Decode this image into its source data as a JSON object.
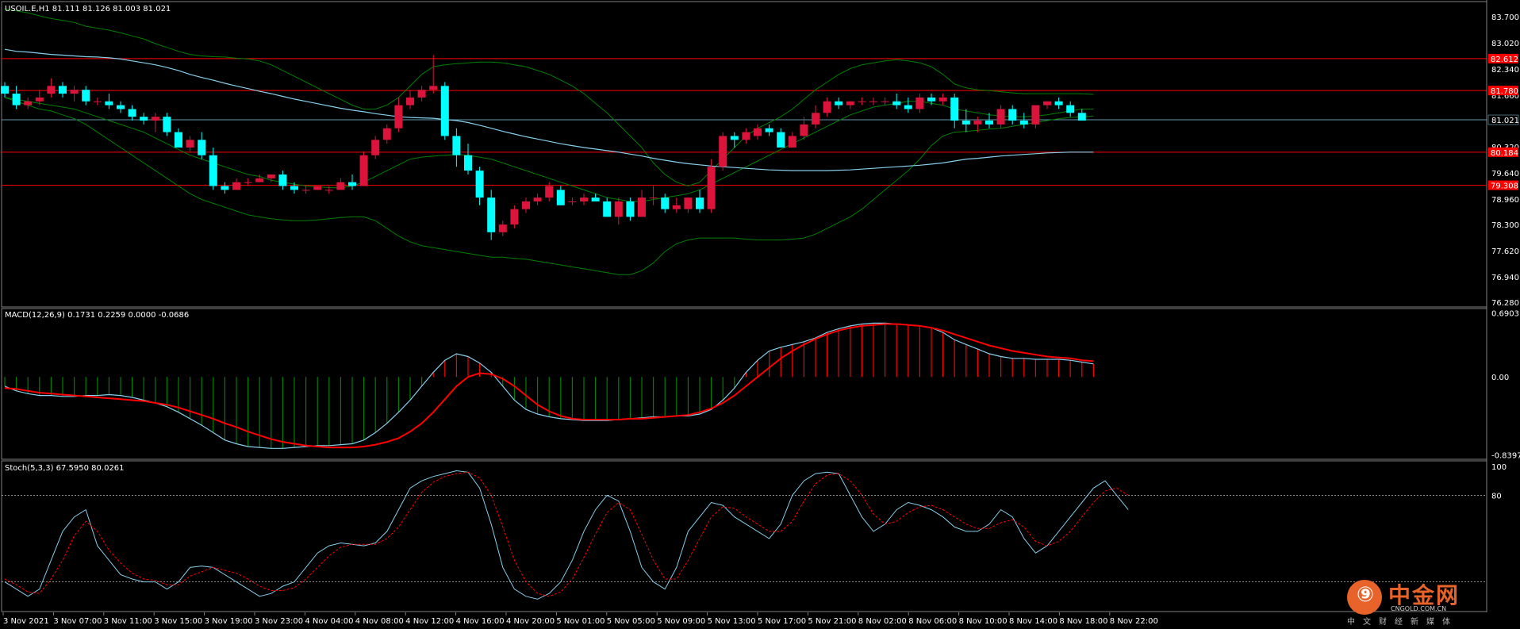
{
  "symbol_header": "USOIL.E,H1  81.111 81.126 81.003 81.021",
  "macd_header": "MACD(12,26,9) 0.1731 0.2259 0.0000 -0.0686",
  "stoch_header": "Stoch(5,3,3) 67.5950 80.0261",
  "colors": {
    "bull": "#dc143c",
    "bear": "#00ffff",
    "bands": "#008000",
    "ma": "#87ceeb",
    "signal": "#ff0000",
    "hist_pos": "#ff0000",
    "hist_neg": "#008000",
    "level": "#ff0000",
    "current": "#87ceeb"
  },
  "price_axis": {
    "ticks": [
      "83.700",
      "83.020",
      "82.340",
      "81.660",
      "81.021",
      "80.320",
      "79.640",
      "78.960",
      "78.300",
      "77.620",
      "76.940",
      "76.280"
    ],
    "ymax": 84.05,
    "ymin": 76.2
  },
  "price_levels": [
    {
      "value": 82.61,
      "label": "82.612"
    },
    {
      "value": 81.78,
      "label": "81.780"
    },
    {
      "value": 80.18,
      "label": "80.184"
    },
    {
      "value": 79.32,
      "label": "79.308"
    }
  ],
  "current_price": {
    "value": 81.021,
    "label": "81.021"
  },
  "macd_axis": {
    "ticks": [
      "0.6903",
      "0.00",
      "-0.8397"
    ],
    "ymax": 0.72,
    "ymin": -0.87
  },
  "stoch_axis": {
    "ticks": [
      "100",
      "80"
    ],
    "levels": [
      80,
      20
    ]
  },
  "time_labels": [
    "3 Nov 2021",
    "3 Nov 07:00",
    "3 Nov 11:00",
    "3 Nov 15:00",
    "3 Nov 19:00",
    "3 Nov 23:00",
    "4 Nov 04:00",
    "4 Nov 08:00",
    "4 Nov 12:00",
    "4 Nov 16:00",
    "4 Nov 20:00",
    "5 Nov 01:00",
    "5 Nov 05:00",
    "5 Nov 09:00",
    "5 Nov 13:00",
    "5 Nov 17:00",
    "5 Nov 21:00",
    "8 Nov 02:00",
    "8 Nov 06:00",
    "8 Nov 10:00",
    "8 Nov 14:00",
    "8 Nov 18:00",
    "8 Nov 22:00"
  ],
  "chart_data": {
    "type": "candlestick",
    "candles": [
      [
        81.9,
        82.0,
        81.6,
        81.7
      ],
      [
        81.7,
        81.9,
        81.3,
        81.4
      ],
      [
        81.4,
        81.6,
        81.3,
        81.5
      ],
      [
        81.5,
        81.8,
        81.4,
        81.6
      ],
      [
        81.7,
        82.1,
        81.6,
        81.9
      ],
      [
        81.9,
        82.0,
        81.6,
        81.7
      ],
      [
        81.7,
        81.9,
        81.5,
        81.8
      ],
      [
        81.8,
        81.9,
        81.4,
        81.5
      ],
      [
        81.5,
        81.6,
        81.4,
        81.5
      ],
      [
        81.5,
        81.7,
        81.3,
        81.4
      ],
      [
        81.4,
        81.5,
        81.2,
        81.3
      ],
      [
        81.3,
        81.4,
        81.0,
        81.1
      ],
      [
        81.1,
        81.2,
        80.9,
        81.0
      ],
      [
        81.0,
        81.2,
        80.7,
        81.1
      ],
      [
        81.1,
        81.2,
        80.6,
        80.7
      ],
      [
        80.7,
        80.8,
        80.3,
        80.3
      ],
      [
        80.3,
        80.6,
        80.2,
        80.5
      ],
      [
        80.5,
        80.7,
        80.0,
        80.1
      ],
      [
        80.1,
        80.3,
        79.2,
        79.3
      ],
      [
        79.3,
        79.4,
        79.1,
        79.2
      ],
      [
        79.2,
        79.5,
        79.2,
        79.4
      ],
      [
        79.4,
        79.5,
        79.3,
        79.4
      ],
      [
        79.4,
        79.6,
        79.4,
        79.5
      ],
      [
        79.5,
        79.6,
        79.4,
        79.6
      ],
      [
        79.6,
        79.7,
        79.2,
        79.3
      ],
      [
        79.3,
        79.4,
        79.1,
        79.2
      ],
      [
        79.2,
        79.3,
        79.1,
        79.2
      ],
      [
        79.2,
        79.3,
        79.2,
        79.3
      ],
      [
        79.2,
        79.3,
        79.1,
        79.2
      ],
      [
        79.2,
        79.5,
        79.2,
        79.4
      ],
      [
        79.4,
        79.6,
        79.2,
        79.3
      ],
      [
        79.3,
        80.2,
        79.3,
        80.1
      ],
      [
        80.1,
        80.6,
        80.0,
        80.5
      ],
      [
        80.5,
        80.9,
        80.4,
        80.8
      ],
      [
        80.8,
        81.6,
        80.7,
        81.4
      ],
      [
        81.4,
        81.8,
        81.3,
        81.6
      ],
      [
        81.6,
        81.9,
        81.5,
        81.8
      ],
      [
        81.8,
        82.7,
        81.7,
        81.9
      ],
      [
        81.9,
        82.0,
        80.5,
        80.6
      ],
      [
        80.6,
        80.8,
        79.8,
        80.1
      ],
      [
        80.1,
        80.4,
        79.6,
        79.7
      ],
      [
        79.7,
        79.8,
        78.8,
        79.0
      ],
      [
        79.0,
        79.2,
        77.9,
        78.1
      ],
      [
        78.1,
        78.4,
        78.0,
        78.3
      ],
      [
        78.3,
        78.8,
        78.2,
        78.7
      ],
      [
        78.7,
        79.0,
        78.6,
        78.9
      ],
      [
        78.9,
        79.1,
        78.8,
        79.0
      ],
      [
        79.0,
        79.4,
        78.9,
        79.3
      ],
      [
        79.2,
        79.3,
        78.8,
        78.8
      ],
      [
        78.9,
        79.0,
        78.8,
        78.9
      ],
      [
        78.9,
        79.1,
        78.8,
        79.0
      ],
      [
        79.0,
        79.1,
        78.9,
        78.9
      ],
      [
        78.9,
        79.0,
        78.5,
        78.5
      ],
      [
        78.5,
        79.0,
        78.3,
        78.9
      ],
      [
        78.9,
        79.0,
        78.4,
        78.5
      ],
      [
        78.5,
        79.2,
        78.5,
        79.0
      ],
      [
        79.0,
        79.3,
        78.8,
        79.0
      ],
      [
        79.0,
        79.1,
        78.6,
        78.7
      ],
      [
        78.7,
        79.0,
        78.6,
        78.8
      ],
      [
        78.7,
        79.0,
        78.6,
        79.0
      ],
      [
        79.0,
        79.2,
        78.6,
        78.7
      ],
      [
        78.7,
        80.0,
        78.6,
        79.8
      ],
      [
        79.8,
        80.7,
        79.7,
        80.6
      ],
      [
        80.6,
        80.7,
        80.3,
        80.5
      ],
      [
        80.5,
        80.8,
        80.4,
        80.7
      ],
      [
        80.6,
        80.9,
        80.5,
        80.8
      ],
      [
        80.8,
        80.9,
        80.6,
        80.7
      ],
      [
        80.7,
        80.8,
        80.3,
        80.3
      ],
      [
        80.3,
        80.7,
        80.3,
        80.6
      ],
      [
        80.6,
        81.1,
        80.5,
        80.9
      ],
      [
        80.9,
        81.4,
        80.8,
        81.2
      ],
      [
        81.2,
        81.6,
        81.1,
        81.5
      ],
      [
        81.5,
        81.6,
        81.3,
        81.4
      ],
      [
        81.4,
        81.5,
        81.3,
        81.5
      ],
      [
        81.5,
        81.6,
        81.4,
        81.5
      ],
      [
        81.5,
        81.6,
        81.4,
        81.5
      ],
      [
        81.5,
        81.6,
        81.4,
        81.5
      ],
      [
        81.5,
        81.7,
        81.3,
        81.4
      ],
      [
        81.4,
        81.6,
        81.2,
        81.3
      ],
      [
        81.3,
        81.7,
        81.2,
        81.6
      ],
      [
        81.6,
        81.7,
        81.4,
        81.5
      ],
      [
        81.5,
        81.7,
        81.4,
        81.6
      ],
      [
        81.6,
        81.7,
        80.8,
        81.0
      ],
      [
        81.0,
        81.3,
        80.7,
        80.9
      ],
      [
        80.9,
        81.1,
        80.7,
        81.0
      ],
      [
        81.0,
        81.2,
        80.8,
        80.9
      ],
      [
        80.9,
        81.4,
        80.8,
        81.3
      ],
      [
        81.3,
        81.4,
        80.9,
        81.0
      ],
      [
        81.0,
        81.2,
        80.8,
        80.9
      ],
      [
        80.9,
        81.4,
        80.8,
        81.4
      ],
      [
        81.4,
        81.5,
        81.3,
        81.5
      ],
      [
        81.5,
        81.6,
        81.3,
        81.4
      ],
      [
        81.4,
        81.5,
        81.1,
        81.2
      ],
      [
        81.2,
        81.3,
        81.0,
        81.0
      ]
    ],
    "ma": [
      82.85,
      82.8,
      82.78,
      82.75,
      82.72,
      82.7,
      82.68,
      82.66,
      82.65,
      82.63,
      82.6,
      82.55,
      82.5,
      82.45,
      82.38,
      82.3,
      82.2,
      82.12,
      82.05,
      81.97,
      81.9,
      81.83,
      81.76,
      81.7,
      81.63,
      81.56,
      81.5,
      81.44,
      81.38,
      81.32,
      81.27,
      81.23,
      81.18,
      81.14,
      81.1,
      81.08,
      81.07,
      81.06,
      81.03,
      81.0,
      80.95,
      80.88,
      80.8,
      80.72,
      80.65,
      80.58,
      80.52,
      80.46,
      80.4,
      80.35,
      80.3,
      80.26,
      80.22,
      80.18,
      80.13,
      80.08,
      80.02,
      79.97,
      79.92,
      79.88,
      79.85,
      79.82,
      79.8,
      79.78,
      79.76,
      79.74,
      79.72,
      79.71,
      79.7,
      79.7,
      79.7,
      79.7,
      79.71,
      79.72,
      79.74,
      79.76,
      79.78,
      79.8,
      79.82,
      79.84,
      79.87,
      79.9,
      79.95,
      80.0,
      80.02,
      80.05,
      80.08,
      80.1,
      80.12,
      80.14,
      80.16,
      80.17,
      80.18,
      80.18,
      80.18
    ],
    "bb_upper": [
      83.9,
      83.85,
      83.8,
      83.72,
      83.65,
      83.6,
      83.55,
      83.45,
      83.4,
      83.35,
      83.28,
      83.2,
      83.12,
      83.0,
      82.9,
      82.8,
      82.72,
      82.68,
      82.66,
      82.65,
      82.62,
      82.6,
      82.55,
      82.45,
      82.3,
      82.15,
      82.0,
      81.85,
      81.7,
      81.55,
      81.4,
      81.3,
      81.3,
      81.4,
      81.6,
      81.9,
      82.2,
      82.4,
      82.45,
      82.48,
      82.5,
      82.52,
      82.52,
      82.5,
      82.45,
      82.4,
      82.3,
      82.2,
      82.05,
      81.9,
      81.7,
      81.45,
      81.2,
      80.9,
      80.6,
      80.3,
      79.9,
      79.6,
      79.4,
      79.3,
      79.4,
      79.7,
      80.0,
      80.3,
      80.6,
      80.8,
      80.95,
      81.1,
      81.3,
      81.55,
      81.8,
      82.0,
      82.2,
      82.35,
      82.45,
      82.5,
      82.55,
      82.58,
      82.55,
      82.5,
      82.4,
      82.2,
      81.95,
      81.85,
      81.8,
      81.78,
      81.75,
      81.72,
      81.7,
      81.7,
      81.7,
      81.7,
      81.7,
      81.7,
      81.68
    ],
    "bb_lower": [
      81.6,
      81.5,
      81.4,
      81.3,
      81.25,
      81.15,
      81.05,
      80.9,
      80.7,
      80.5,
      80.3,
      80.1,
      79.9,
      79.7,
      79.5,
      79.3,
      79.1,
      78.95,
      78.85,
      78.75,
      78.65,
      78.55,
      78.5,
      78.45,
      78.42,
      78.4,
      78.4,
      78.42,
      78.45,
      78.48,
      78.5,
      78.5,
      78.4,
      78.2,
      78.0,
      77.85,
      77.75,
      77.7,
      77.65,
      77.6,
      77.55,
      77.5,
      77.45,
      77.45,
      77.42,
      77.4,
      77.35,
      77.3,
      77.25,
      77.2,
      77.15,
      77.1,
      77.05,
      77.0,
      77.0,
      77.1,
      77.3,
      77.6,
      77.8,
      77.9,
      77.95,
      77.95,
      77.95,
      77.95,
      77.92,
      77.9,
      77.9,
      77.9,
      77.92,
      77.95,
      78.05,
      78.2,
      78.35,
      78.5,
      78.7,
      78.95,
      79.2,
      79.45,
      79.7,
      80.0,
      80.35,
      80.6,
      80.7,
      80.72,
      80.75,
      80.78,
      80.8,
      80.85,
      80.9,
      80.95,
      81.0,
      81.05,
      81.08,
      81.1,
      81.12
    ],
    "bb_mid": [
      81.6,
      81.55,
      81.5,
      81.45,
      81.4,
      81.35,
      81.3,
      81.2,
      81.1,
      81.0,
      80.9,
      80.8,
      80.7,
      80.55,
      80.4,
      80.25,
      80.1,
      80.0,
      79.9,
      79.8,
      79.7,
      79.6,
      79.55,
      79.45,
      79.4,
      79.35,
      79.3,
      79.28,
      79.26,
      79.25,
      79.3,
      79.4,
      79.55,
      79.7,
      79.85,
      80.0,
      80.05,
      80.08,
      80.1,
      80.12,
      80.1,
      80.05,
      80.0,
      79.9,
      79.8,
      79.7,
      79.6,
      79.5,
      79.4,
      79.3,
      79.2,
      79.1,
      79.0,
      78.95,
      78.9,
      78.9,
      78.95,
      79.0,
      79.05,
      79.1,
      79.2,
      79.35,
      79.5,
      79.65,
      79.8,
      79.95,
      80.1,
      80.25,
      80.4,
      80.55,
      80.7,
      80.85,
      81.0,
      81.15,
      81.25,
      81.35,
      81.4,
      81.45,
      81.5,
      81.5,
      81.45,
      81.4,
      81.3,
      81.25,
      81.2,
      81.15,
      81.12,
      81.1,
      81.1,
      81.12,
      81.15,
      81.2,
      81.25,
      81.3,
      81.3
    ],
    "macd_main": [
      -0.1,
      -0.15,
      -0.18,
      -0.2,
      -0.2,
      -0.21,
      -0.21,
      -0.2,
      -0.2,
      -0.19,
      -0.2,
      -0.22,
      -0.25,
      -0.28,
      -0.32,
      -0.38,
      -0.45,
      -0.52,
      -0.6,
      -0.68,
      -0.72,
      -0.75,
      -0.76,
      -0.77,
      -0.77,
      -0.76,
      -0.75,
      -0.74,
      -0.74,
      -0.73,
      -0.72,
      -0.68,
      -0.6,
      -0.5,
      -0.38,
      -0.25,
      -0.1,
      0.05,
      0.18,
      0.25,
      0.22,
      0.15,
      0.05,
      -0.1,
      -0.25,
      -0.35,
      -0.4,
      -0.43,
      -0.45,
      -0.46,
      -0.47,
      -0.47,
      -0.47,
      -0.46,
      -0.45,
      -0.44,
      -0.43,
      -0.43,
      -0.42,
      -0.42,
      -0.4,
      -0.35,
      -0.25,
      -0.12,
      0.05,
      0.18,
      0.28,
      0.32,
      0.35,
      0.38,
      0.42,
      0.48,
      0.52,
      0.55,
      0.57,
      0.58,
      0.58,
      0.57,
      0.56,
      0.55,
      0.53,
      0.48,
      0.4,
      0.35,
      0.3,
      0.25,
      0.22,
      0.2,
      0.2,
      0.19,
      0.19,
      0.19,
      0.18,
      0.16,
      0.14
    ],
    "macd_signal": [
      -0.12,
      -0.13,
      -0.15,
      -0.17,
      -0.18,
      -0.19,
      -0.2,
      -0.21,
      -0.22,
      -0.23,
      -0.24,
      -0.25,
      -0.26,
      -0.28,
      -0.3,
      -0.33,
      -0.37,
      -0.41,
      -0.45,
      -0.5,
      -0.54,
      -0.59,
      -0.63,
      -0.67,
      -0.7,
      -0.72,
      -0.74,
      -0.75,
      -0.76,
      -0.76,
      -0.76,
      -0.75,
      -0.73,
      -0.7,
      -0.66,
      -0.59,
      -0.5,
      -0.38,
      -0.24,
      -0.1,
      0.0,
      0.04,
      0.03,
      -0.02,
      -0.1,
      -0.2,
      -0.3,
      -0.37,
      -0.42,
      -0.45,
      -0.46,
      -0.46,
      -0.46,
      -0.46,
      -0.45,
      -0.45,
      -0.44,
      -0.43,
      -0.42,
      -0.41,
      -0.38,
      -0.34,
      -0.28,
      -0.2,
      -0.1,
      0.0,
      0.1,
      0.2,
      0.28,
      0.35,
      0.41,
      0.46,
      0.5,
      0.53,
      0.55,
      0.56,
      0.57,
      0.57,
      0.56,
      0.55,
      0.53,
      0.5,
      0.46,
      0.42,
      0.38,
      0.34,
      0.31,
      0.28,
      0.26,
      0.24,
      0.22,
      0.21,
      0.2,
      0.18,
      0.17
    ],
    "stoch_main": [
      20,
      15,
      10,
      15,
      35,
      55,
      65,
      70,
      45,
      35,
      25,
      22,
      20,
      20,
      15,
      20,
      30,
      31,
      30,
      25,
      20,
      15,
      10,
      12,
      17,
      20,
      30,
      40,
      45,
      47,
      46,
      45,
      47,
      55,
      70,
      85,
      90,
      93,
      95,
      97,
      96,
      85,
      60,
      30,
      15,
      10,
      8,
      12,
      20,
      35,
      55,
      70,
      80,
      76,
      55,
      30,
      20,
      15,
      30,
      55,
      65,
      75,
      73,
      65,
      60,
      55,
      50,
      60,
      80,
      90,
      95,
      96,
      95,
      80,
      65,
      55,
      60,
      70,
      75,
      73,
      70,
      65,
      58,
      55,
      55,
      60,
      70,
      65,
      50,
      40,
      45,
      55,
      65,
      75,
      85,
      90,
      80,
      70
    ],
    "stoch_signal": [
      22,
      18,
      13,
      12,
      22,
      35,
      52,
      62,
      55,
      42,
      33,
      26,
      22,
      21,
      18,
      18,
      24,
      27,
      30,
      28,
      26,
      22,
      17,
      14,
      14,
      16,
      22,
      30,
      38,
      44,
      46,
      46,
      46,
      50,
      58,
      70,
      82,
      89,
      93,
      95,
      96,
      92,
      80,
      58,
      35,
      20,
      12,
      10,
      13,
      22,
      37,
      53,
      68,
      75,
      70,
      53,
      35,
      22,
      22,
      35,
      50,
      65,
      72,
      71,
      65,
      60,
      55,
      55,
      62,
      76,
      88,
      94,
      95,
      90,
      80,
      67,
      60,
      62,
      68,
      72,
      73,
      70,
      65,
      60,
      57,
      57,
      61,
      63,
      58,
      48,
      45,
      48,
      55,
      65,
      75,
      83,
      85,
      80
    ]
  }
}
